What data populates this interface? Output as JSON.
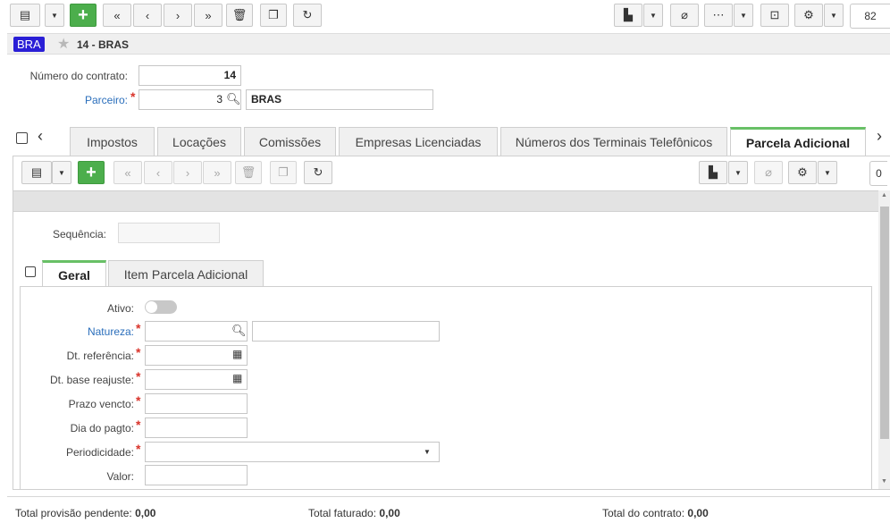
{
  "top_toolbar": {
    "page_number": "82"
  },
  "header": {
    "badge": "BRA",
    "title": "14 - BRAS"
  },
  "contract": {
    "numero_label": "Número do contrato:",
    "numero_value": "14",
    "parceiro_label": "Parceiro:",
    "parceiro_code": "3",
    "parceiro_name": "BRAS"
  },
  "tabs": [
    "Impostos",
    "Locações",
    "Comissões",
    "Empresas Licenciadas",
    "Números dos Terminais Telefônicos",
    "Parcela Adicional"
  ],
  "sub_toolbar": {
    "page_number": "0"
  },
  "detail": {
    "sequencia_label": "Sequência:",
    "sequencia_value": ""
  },
  "subtabs": [
    "Geral",
    "Item Parcela Adicional"
  ],
  "form": {
    "ativo_label": "Ativo:",
    "natureza_label": "Natureza:",
    "dt_referencia_label": "Dt. referência:",
    "dt_base_reajuste_label": "Dt. base reajuste:",
    "prazo_vencto_label": "Prazo vencto:",
    "dia_pagto_label": "Dia do pagto:",
    "periodicidade_label": "Periodicidade:",
    "valor_label": "Valor:"
  },
  "footer": {
    "provisao_label": "Total provisão pendente:",
    "provisao_value": "0,00",
    "faturado_label": "Total faturado:",
    "faturado_value": "0,00",
    "contrato_label": "Total do contrato:",
    "contrato_value": "0,00"
  },
  "colors": {
    "accent_green": "#4cae4c",
    "badge_blue": "#2a1fd6",
    "link_blue": "#2a6ebb",
    "required_red": "#d9342b"
  }
}
